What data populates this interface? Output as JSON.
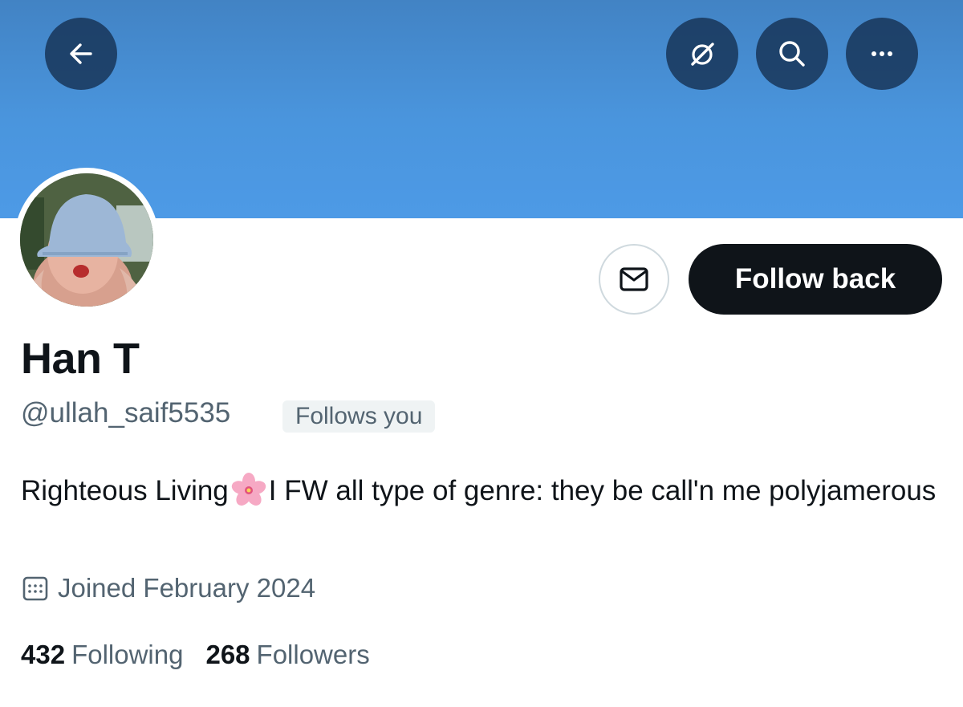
{
  "header": {
    "back_icon": "arrow-left-icon",
    "grok_icon": "grok-slash-icon",
    "search_icon": "search-icon",
    "more_icon": "more-dots-icon",
    "banner_color": "#4a95dd"
  },
  "profile": {
    "name": "Han T",
    "handle": "@ullah_saif5535",
    "follows_you": "Follows you",
    "bio_part1": "Righteous Living",
    "bio_emoji": "cherry-blossom-emoji",
    "bio_part2": "I FW all type of genre: they be call'n me polyjamerous",
    "joined": "Joined February 2024",
    "following_count": "432",
    "following_label": "Following",
    "followers_count": "268",
    "followers_label": "Followers"
  },
  "actions": {
    "message_icon": "envelope-icon",
    "follow_label": "Follow back"
  }
}
